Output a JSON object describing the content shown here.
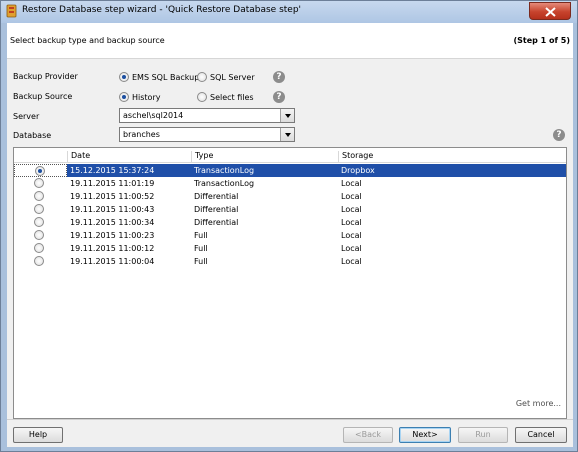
{
  "window": {
    "title": "Restore Database step wizard - 'Quick Restore Database step'"
  },
  "header": {
    "text": "Select backup type and backup source",
    "step": "(Step 1 of 5)"
  },
  "form": {
    "backup_provider": {
      "label": "Backup Provider",
      "options": [
        "EMS SQL Backup",
        "SQL Server"
      ],
      "selected": "EMS SQL Backup"
    },
    "backup_source": {
      "label": "Backup Source",
      "options": [
        "History",
        "Select files"
      ],
      "selected": "History"
    },
    "server": {
      "label": "Server",
      "value": "aschel\\sql2014"
    },
    "database": {
      "label": "Database",
      "value": "branches"
    }
  },
  "grid": {
    "columns": [
      "Date",
      "Type",
      "Storage"
    ],
    "rows": [
      {
        "date": "15.12.2015 15:37:24",
        "type": "TransactionLog",
        "storage": "Dropbox",
        "selected": true
      },
      {
        "date": "19.11.2015 11:01:19",
        "type": "TransactionLog",
        "storage": "Local",
        "selected": false
      },
      {
        "date": "19.11.2015 11:00:52",
        "type": "Differential",
        "storage": "Local",
        "selected": false
      },
      {
        "date": "19.11.2015 11:00:43",
        "type": "Differential",
        "storage": "Local",
        "selected": false
      },
      {
        "date": "19.11.2015 11:00:34",
        "type": "Differential",
        "storage": "Local",
        "selected": false
      },
      {
        "date": "19.11.2015 11:00:23",
        "type": "Full",
        "storage": "Local",
        "selected": false
      },
      {
        "date": "19.11.2015 11:00:12",
        "type": "Full",
        "storage": "Local",
        "selected": false
      },
      {
        "date": "19.11.2015 11:00:04",
        "type": "Full",
        "storage": "Local",
        "selected": false
      }
    ],
    "get_more": "Get more..."
  },
  "buttons": {
    "help": "Help",
    "back": "<Back",
    "next": "Next>",
    "run": "Run",
    "cancel": "Cancel"
  },
  "colors": {
    "selection": "#1f4fa8",
    "title_bar": "#aec6e4",
    "close": "#c7432d"
  },
  "icons": {
    "app": "database-restore-icon",
    "close": "close-icon",
    "help": "help-icon"
  }
}
